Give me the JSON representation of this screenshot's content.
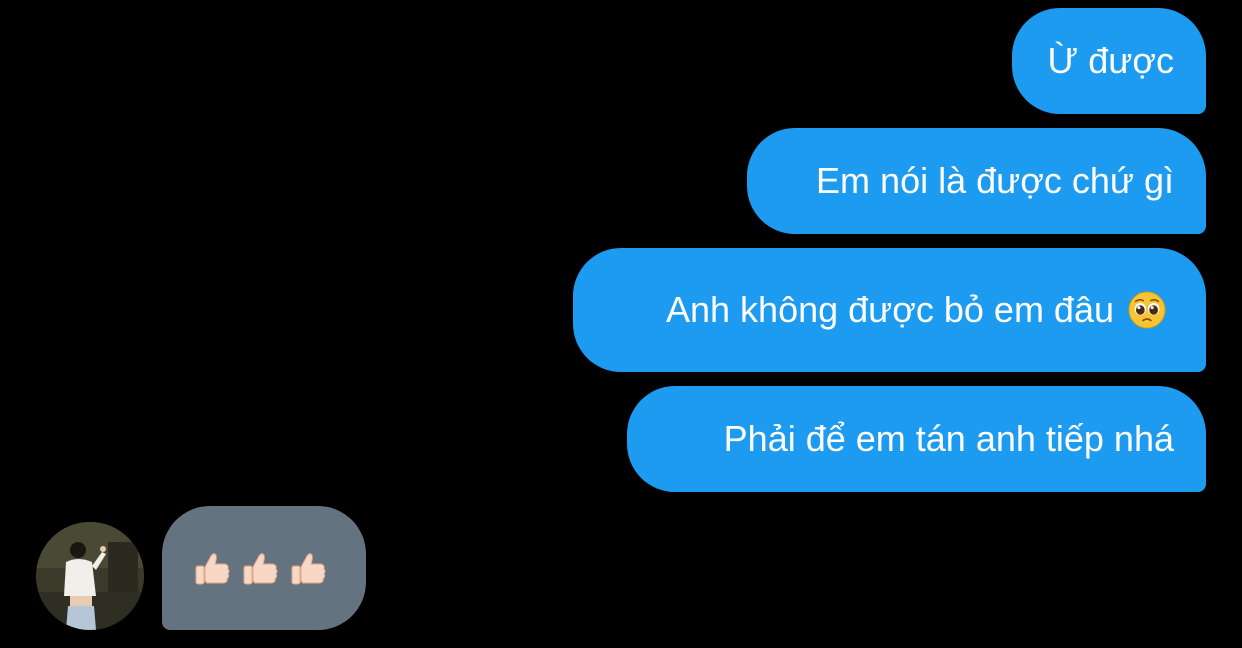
{
  "conversation": {
    "messages": [
      {
        "direction": "sent",
        "text": "Ừ được"
      },
      {
        "direction": "sent",
        "text": "Em nói là được chứ gì"
      },
      {
        "direction": "sent",
        "text": "Anh không được bỏ em đâu",
        "emoji": "pleading-face"
      },
      {
        "direction": "sent",
        "text": "Phải để em tán anh tiếp nhá"
      },
      {
        "direction": "received",
        "emoji": [
          "thumbs-up-light-skin",
          "thumbs-up-light-skin",
          "thumbs-up-light-skin"
        ]
      }
    ]
  },
  "colors": {
    "background": "#000000",
    "sent_bubble": "#1d9bf0",
    "received_bubble": "#64737f",
    "text": "#ffffff"
  }
}
